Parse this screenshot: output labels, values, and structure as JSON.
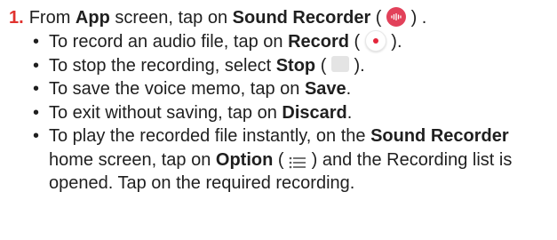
{
  "step": {
    "number": "1.",
    "pre1": "From ",
    "bold1": "App",
    "mid1": " screen, tap on ",
    "bold2": "Sound Recorder",
    "open_paren": " ( ",
    "close_paren": " ) ."
  },
  "bullets": [
    {
      "pre": "To record an audio file, tap on ",
      "bold": "Record",
      "open": " ( ",
      "close": " )."
    },
    {
      "pre": "To stop the recording, select ",
      "bold": "Stop",
      "open": " ( ",
      "close": " )."
    },
    {
      "pre": "To save the voice memo, tap on ",
      "bold": "Save",
      "post": "."
    },
    {
      "pre": "To exit without saving, tap on ",
      "bold": "Discard",
      "post": "."
    },
    {
      "pre": "To play the recorded file instantly, on the ",
      "bold1": "Sound Recorder",
      "mid": " home screen, tap on ",
      "bold2": "Option",
      "open": " ( ",
      "close": " ) and the Recording list is opened. Tap on the required recording."
    }
  ],
  "bullet_glyph": "•",
  "icons": {
    "app": "sound-recorder-app-icon",
    "record": "record-icon",
    "stop": "stop-icon",
    "option": "option-list-icon"
  },
  "colors": {
    "step_number": "#e0322e",
    "app_icon": "#e2415a",
    "record_dot": "#e3253a",
    "stop_square": "#e4e4e4",
    "text": "#1f1f1f"
  }
}
